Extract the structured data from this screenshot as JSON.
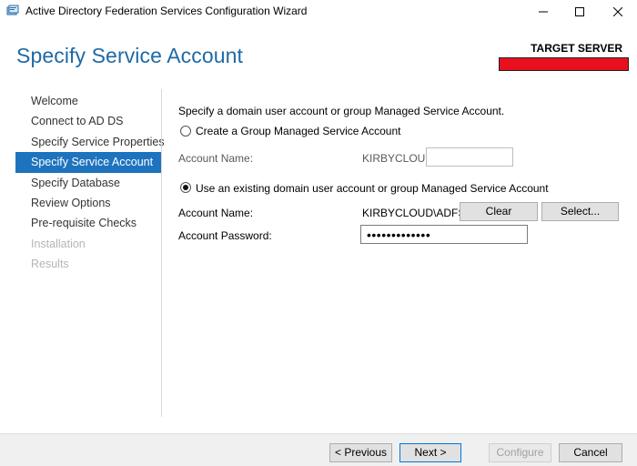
{
  "window": {
    "title": "Active Directory Federation Services Configuration Wizard"
  },
  "header": {
    "page_title": "Specify Service Account",
    "target_label": "TARGET SERVER",
    "target_value_redacted": true,
    "redaction_color": "#e8101e"
  },
  "nav": {
    "items": [
      {
        "label": "Welcome",
        "state": "normal"
      },
      {
        "label": "Connect to AD DS",
        "state": "normal"
      },
      {
        "label": "Specify Service Properties",
        "state": "normal"
      },
      {
        "label": "Specify Service Account",
        "state": "active"
      },
      {
        "label": "Specify Database",
        "state": "normal"
      },
      {
        "label": "Review Options",
        "state": "normal"
      },
      {
        "label": "Pre-requisite Checks",
        "state": "normal"
      },
      {
        "label": "Installation",
        "state": "disabled"
      },
      {
        "label": "Results",
        "state": "disabled"
      }
    ]
  },
  "main": {
    "intro": "Specify a domain user account or group Managed Service Account.",
    "option_gmsa": {
      "label": "Create a Group Managed Service Account",
      "selected": false,
      "account_name_label": "Account Name:",
      "domain_prefix": "KIRBYCLOUD\\",
      "account_name_value": ""
    },
    "option_existing": {
      "label": "Use an existing domain user account or group Managed Service Account",
      "selected": true,
      "account_name_label": "Account Name:",
      "account_name_value": "KIRBYCLOUD\\ADFS...",
      "clear_label": "Clear",
      "select_label": "Select...",
      "password_label": "Account Password:",
      "password_mask": "•••••••••••••"
    }
  },
  "footer": {
    "previous_label": "< Previous",
    "next_label": "Next >",
    "configure_label": "Configure",
    "cancel_label": "Cancel"
  },
  "colors": {
    "accent": "#1e73be",
    "title_blue": "#1e6aa6"
  }
}
